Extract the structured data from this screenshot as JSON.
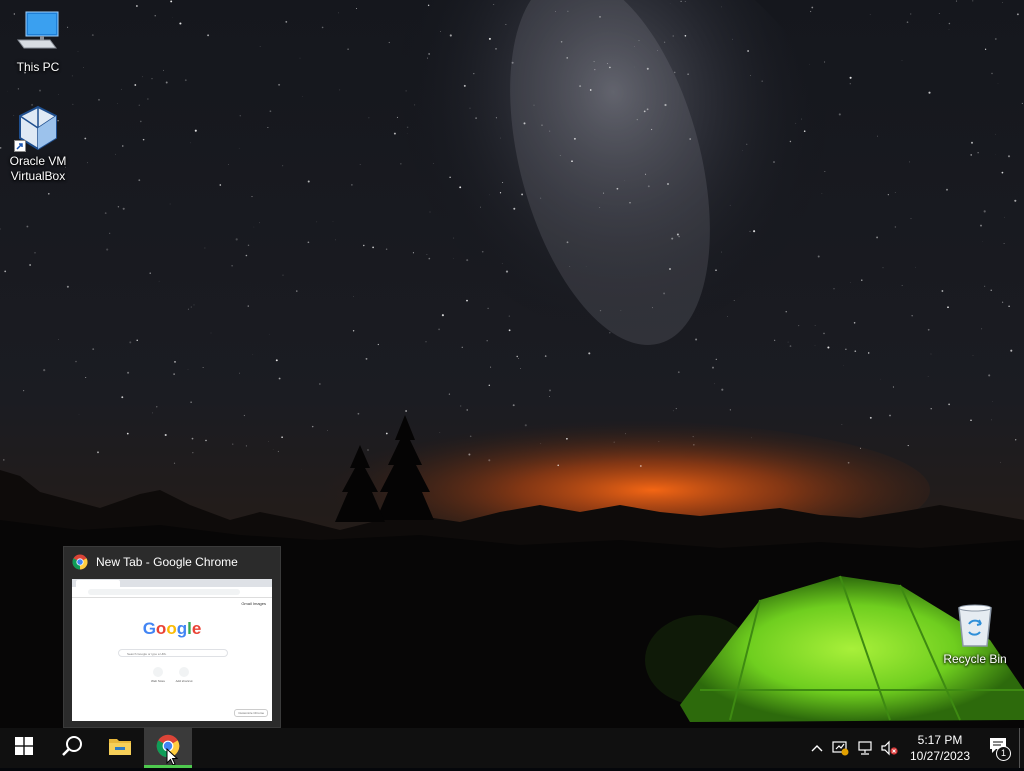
{
  "desktop": {
    "icons": [
      {
        "label": "This PC",
        "icon": "monitor-icon"
      },
      {
        "label": "Oracle VM VirtualBox",
        "icon": "virtualbox-icon"
      },
      {
        "label": "Recycle Bin",
        "icon": "recycle-bin-icon"
      }
    ]
  },
  "preview": {
    "title": "New Tab - Google Chrome",
    "thumb": {
      "logo": "Google",
      "links": "Gmail  Images",
      "search_placeholder": "Search Google or type a URL",
      "shortcuts": [
        "Web Store",
        "Add shortcut"
      ],
      "customize": "Customize Chrome"
    }
  },
  "taskbar": {
    "items": [
      {
        "name": "Start",
        "icon": "windows-logo-icon"
      },
      {
        "name": "Search",
        "icon": "search-icon"
      },
      {
        "name": "File Explorer",
        "icon": "folder-icon"
      },
      {
        "name": "Google Chrome",
        "icon": "chrome-icon",
        "state": "hover"
      }
    ],
    "tray": {
      "icons": [
        "chevron-up-icon",
        "security-alert-icon",
        "network-icon",
        "volume-muted-icon"
      ],
      "time": "5:17 PM",
      "date": "10/27/2023",
      "notification_count": "1"
    }
  },
  "colors": {
    "taskbar": "#101010",
    "tent": "#7fd62e",
    "horizon_glow": "#e0601a",
    "accent": "#76b9ed"
  }
}
